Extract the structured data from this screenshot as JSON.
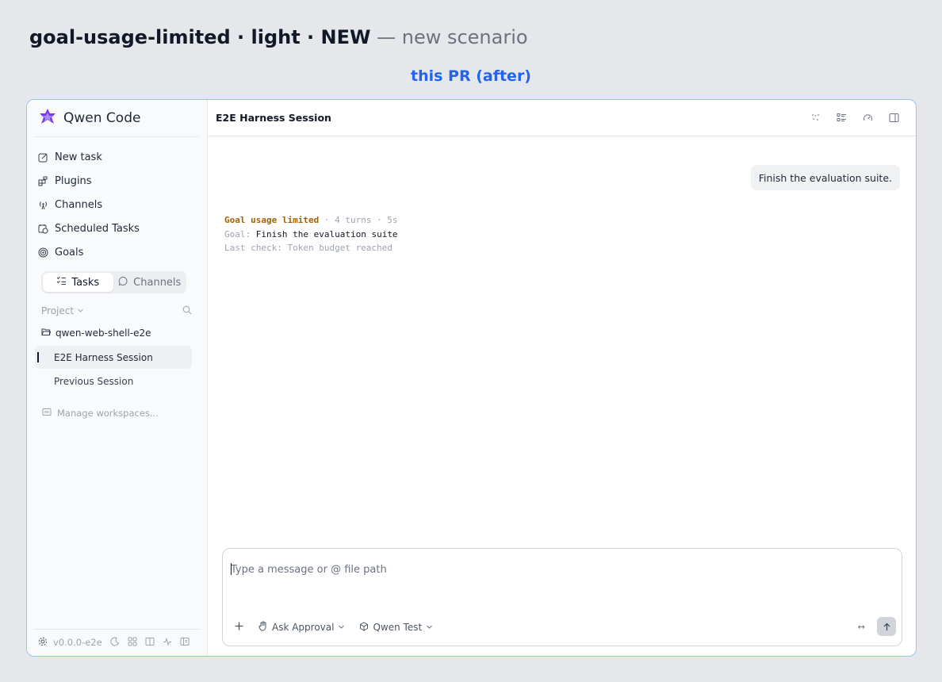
{
  "heading": {
    "scenario": "goal-usage-limited",
    "sep1": " · ",
    "theme": "light",
    "sep2": " · ",
    "badge": "NEW",
    "description": " — new scenario"
  },
  "variant_label": "this PR (after)",
  "app": {
    "name": "Qwen Code",
    "nav": [
      {
        "label": "New task",
        "icon": "edit-icon"
      },
      {
        "label": "Plugins",
        "icon": "plugins-icon"
      },
      {
        "label": "Channels",
        "icon": "broadcast-icon"
      },
      {
        "label": "Scheduled Tasks",
        "icon": "calendar-clock-icon"
      },
      {
        "label": "Goals",
        "icon": "target-icon"
      }
    ],
    "toggle": {
      "tasks": "Tasks",
      "channels": "Channels",
      "active": "tasks"
    },
    "project_label": "Project",
    "project_folder": "qwen-web-shell-e2e",
    "sessions": [
      {
        "label": "E2E Harness Session",
        "active": true
      },
      {
        "label": "Previous Session",
        "active": false
      }
    ],
    "manage_label": "Manage workspaces...",
    "version": "v0.0.0-e2e"
  },
  "main": {
    "session_title": "E2E Harness Session",
    "user_message": "Finish the evaluation suite.",
    "goal": {
      "status": "Goal usage limited",
      "meta": " · 4 turns · 5s",
      "goal_label": "Goal: ",
      "goal_text": "Finish the evaluation suite",
      "last_check": "Last check: Token budget reached"
    },
    "composer": {
      "placeholder": "Type a message or @ file path",
      "approval": "Ask Approval",
      "model": "Qwen Test"
    }
  }
}
